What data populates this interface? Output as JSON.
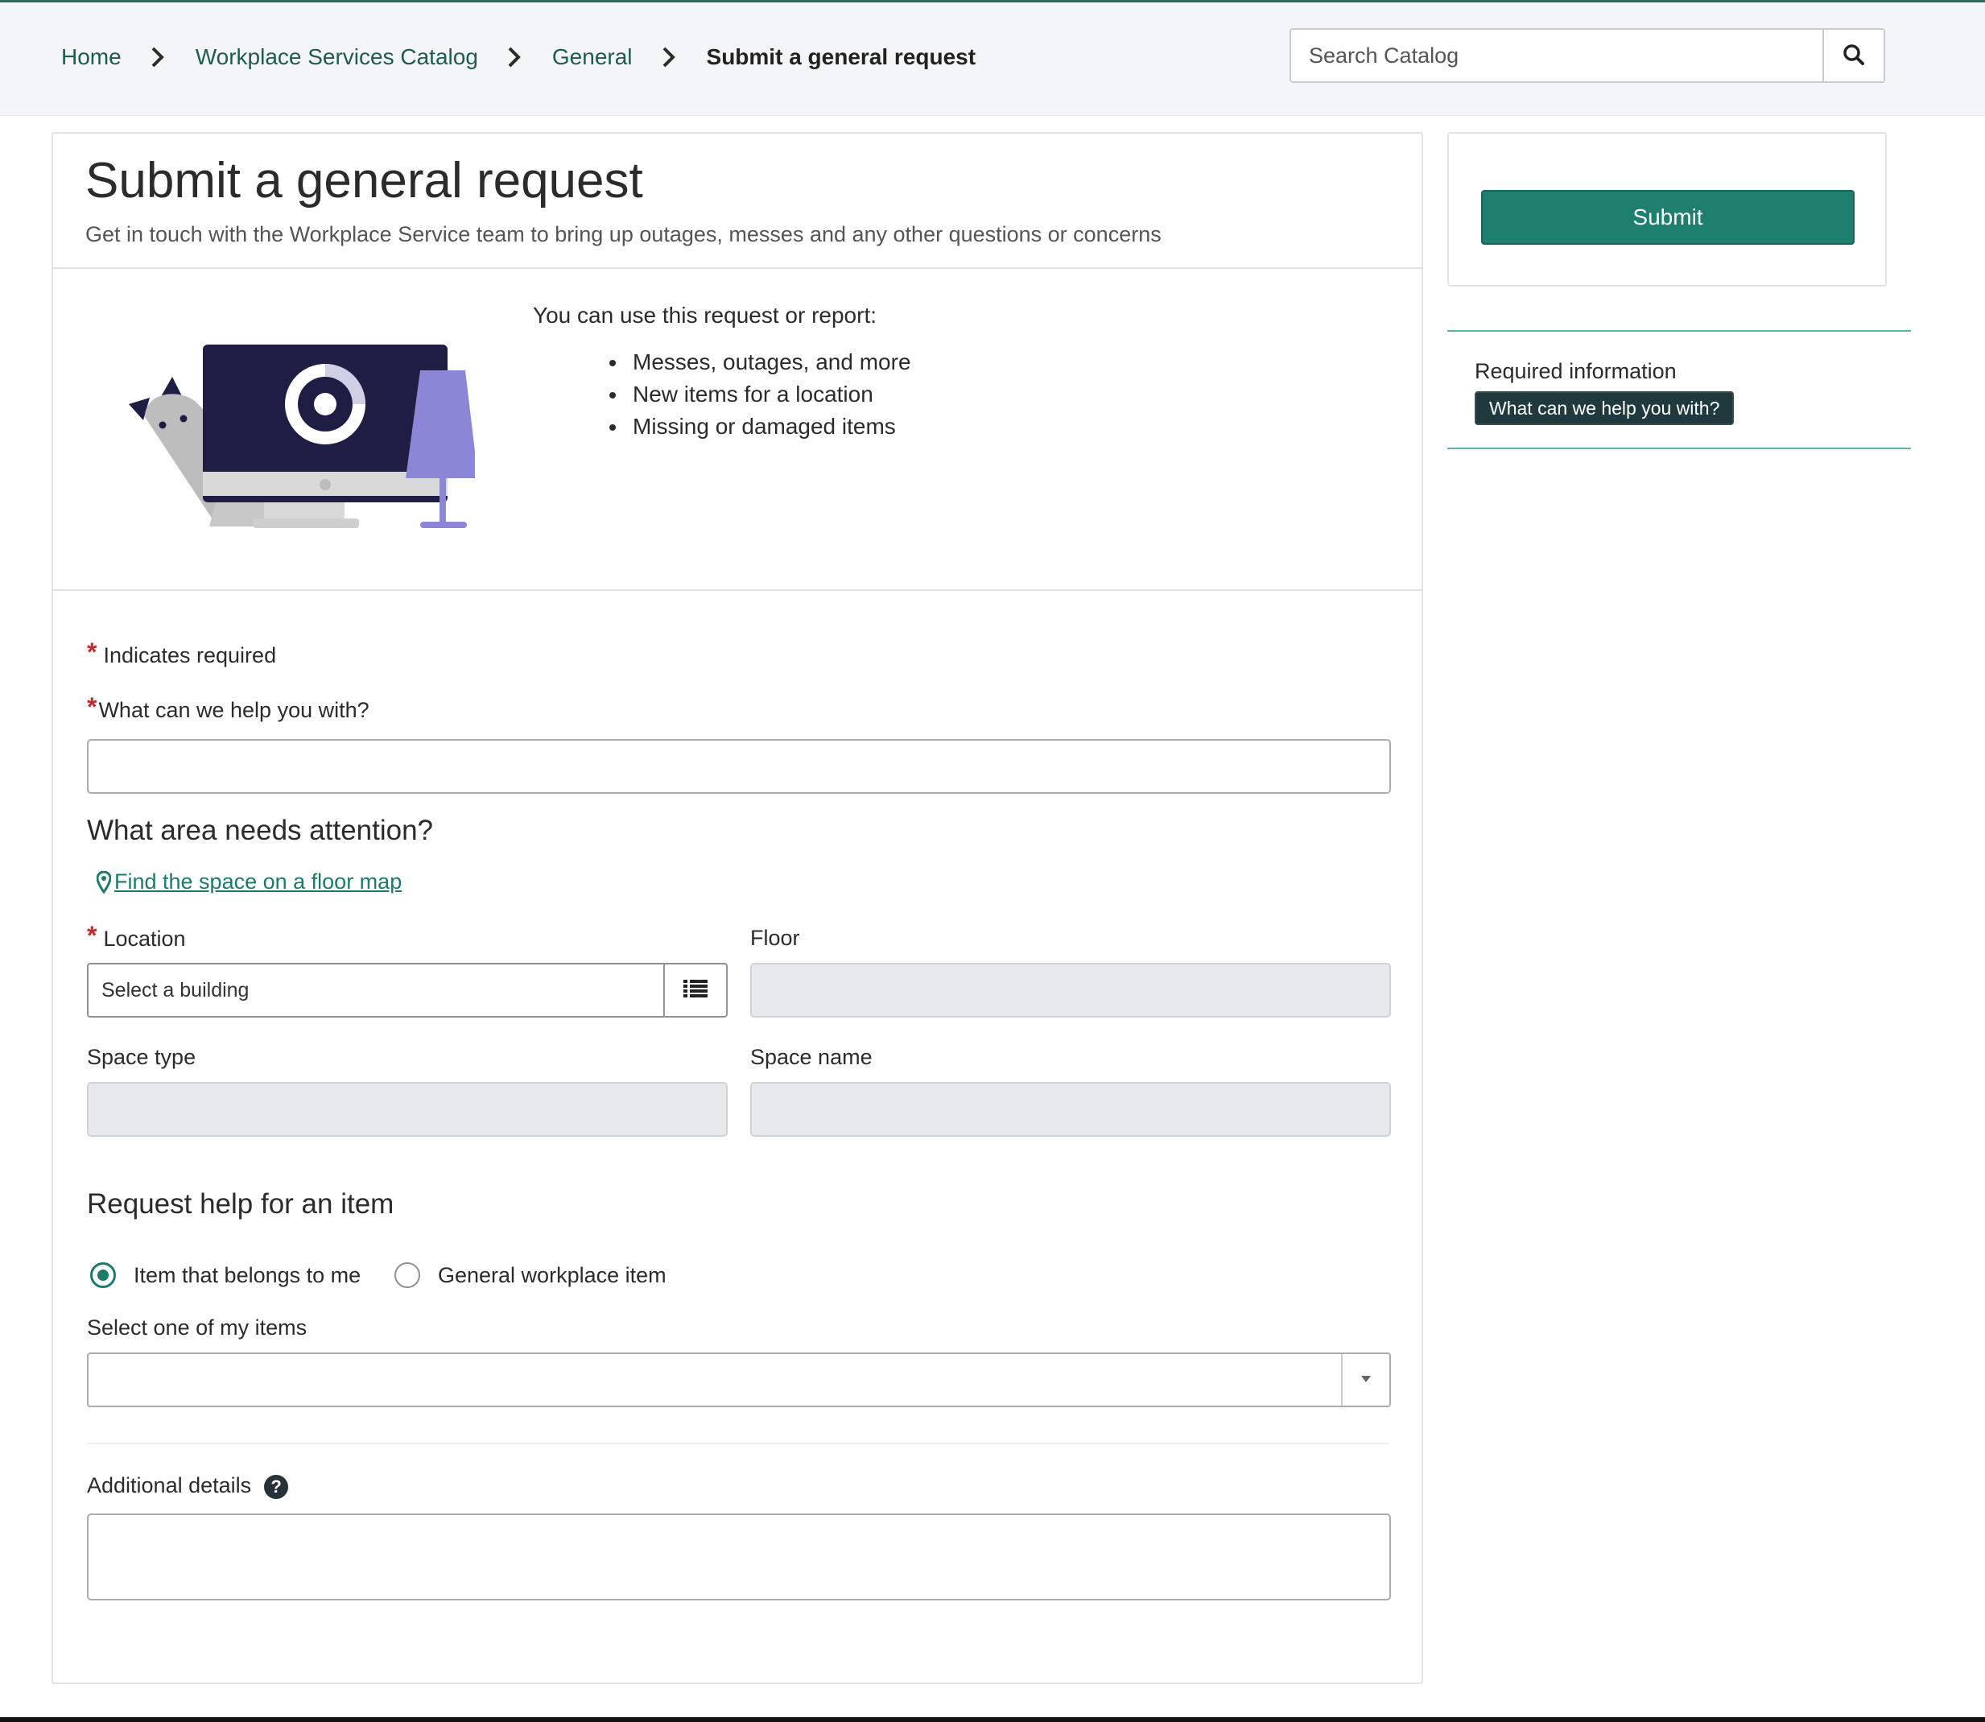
{
  "breadcrumb": {
    "items": [
      {
        "label": "Home"
      },
      {
        "label": "Workplace Services Catalog"
      },
      {
        "label": "General"
      }
    ],
    "current": "Submit a general request"
  },
  "search": {
    "placeholder": "Search Catalog",
    "value": ""
  },
  "page": {
    "title": "Submit a general request",
    "subtitle": "Get in touch with the Workplace Service team to bring up outages, messes and any other questions or concerns"
  },
  "intro": {
    "lead": "You can use this request or report:",
    "items": [
      "Messes, outages, and more",
      "New items for a location",
      "Missing or damaged items"
    ]
  },
  "form": {
    "required_note": "Indicates required",
    "required_mark": "*",
    "help_label": "What can we help you with?",
    "help_value": "",
    "area_title": "What area needs attention?",
    "map_link": "Find the space on a floor map",
    "location_label": "Location",
    "location_placeholder": "Select a building",
    "floor_label": "Floor",
    "space_type_label": "Space type",
    "space_name_label": "Space name",
    "item_section_title": "Request help for an item",
    "radio_options": [
      {
        "label": "Item that belongs to me",
        "checked": true
      },
      {
        "label": "General workplace item",
        "checked": false
      }
    ],
    "my_items_label": "Select one of my items",
    "my_items_value": "",
    "details_label": "Additional details",
    "details_value": ""
  },
  "sidebar": {
    "submit_label": "Submit",
    "required_title": "Required information",
    "required_items": [
      "What can we help you with?"
    ]
  },
  "colors": {
    "accent": "#1e7f6e",
    "link": "#1d5c4f",
    "required": "#c62828",
    "illustration_screen": "#1e1e45",
    "illustration_lamp": "#8b87d6"
  },
  "icons": {
    "search": "search-icon",
    "chevron": "chevron-right-icon",
    "map_marker": "map-marker-icon",
    "list": "list-icon",
    "dropdown": "caret-down-icon",
    "help": "question-circle-icon"
  }
}
